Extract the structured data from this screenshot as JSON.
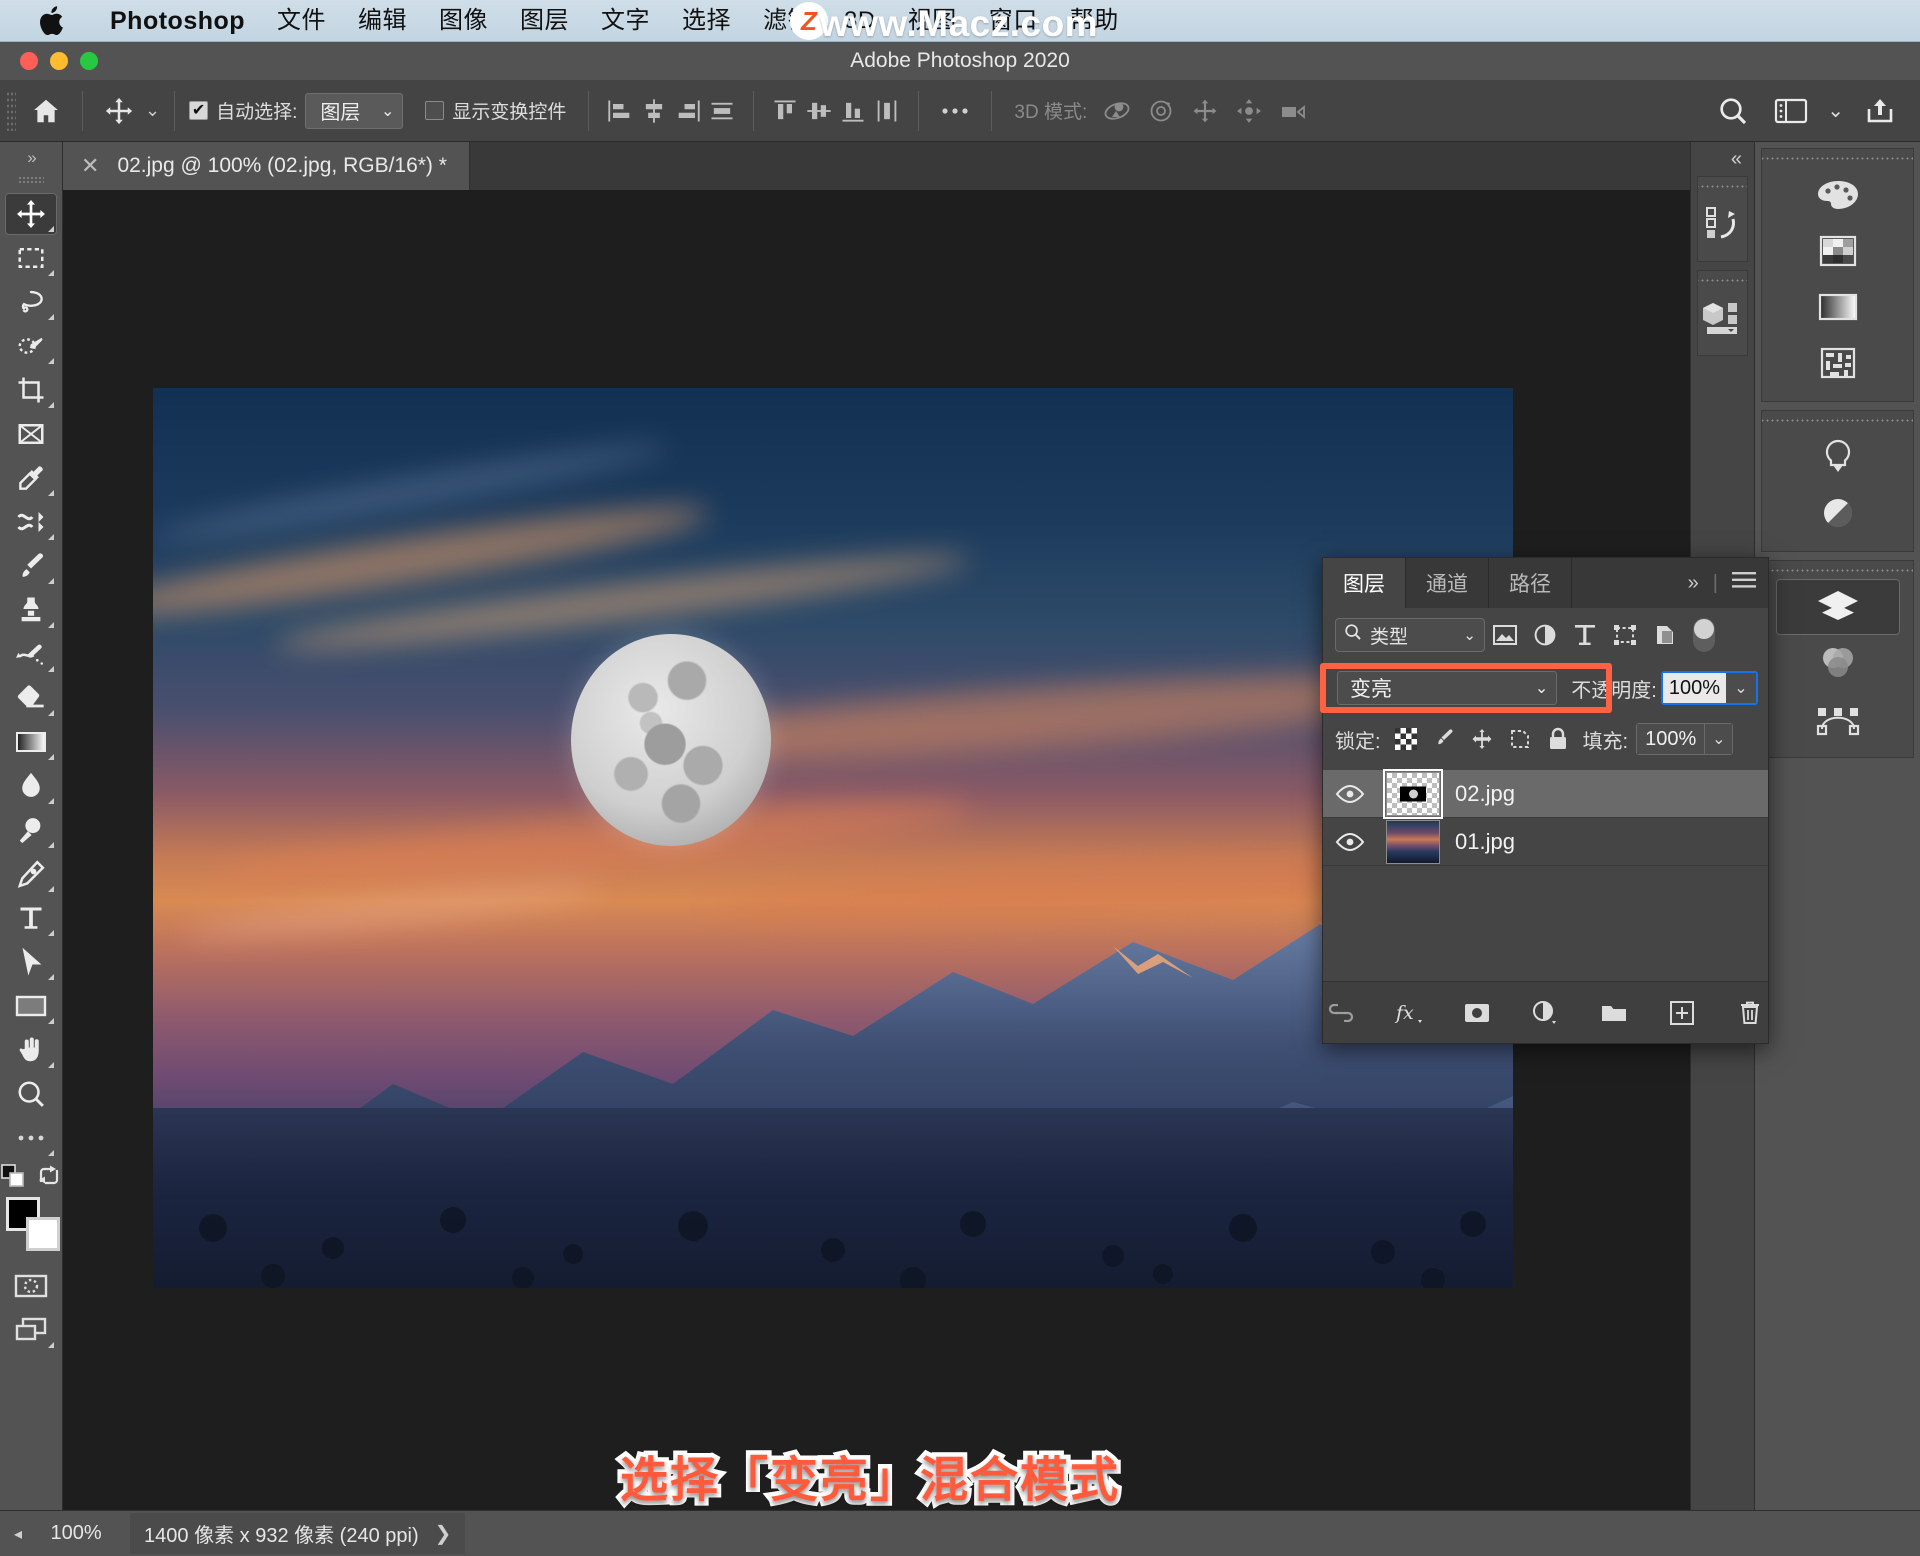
{
  "mac_menu": {
    "apple_icon": "apple-logo-icon",
    "items": [
      {
        "label": "Photoshop",
        "bold": true
      },
      {
        "label": "文件"
      },
      {
        "label": "编辑"
      },
      {
        "label": "图像"
      },
      {
        "label": "图层"
      },
      {
        "label": "文字"
      },
      {
        "label": "选择"
      },
      {
        "label": "滤镜"
      },
      {
        "label": "3D"
      },
      {
        "label": "视图"
      },
      {
        "label": "窗口"
      },
      {
        "label": "帮助"
      }
    ]
  },
  "watermark": {
    "text": "www.Macz.com",
    "badge": "Z"
  },
  "window": {
    "title": "Adobe Photoshop 2020"
  },
  "options_bar": {
    "home_icon": "home-icon",
    "tool_icon": "move-tool-icon",
    "auto_select_label": "自动选择:",
    "auto_select_checked": true,
    "auto_select_value": "图层",
    "show_transform_label": "显示变换控件",
    "show_transform_checked": false,
    "align_left_icon": "align-left-icon",
    "align_center_h_icon": "align-center-horizontal-icon",
    "align_right_icon": "align-right-icon",
    "distribute_h_icon": "distribute-horizontal-icon",
    "align_top_icon": "align-top-icon",
    "align_middle_icon": "align-middle-vertical-icon",
    "align_bottom_icon": "align-bottom-icon",
    "distribute_v_icon": "distribute-vertical-icon",
    "more_icon": "more-options-icon",
    "mode_3d_label": "3D 模式:",
    "mode_3d_icons": [
      "rotate-3d-icon",
      "roll-3d-icon",
      "pan-3d-icon",
      "slide-3d-icon",
      "scale-3d-icon"
    ],
    "search_icon": "search-icon",
    "workspace_icon": "workspace-icon",
    "workspace_chevron_icon": "chevron-down-icon",
    "share_icon": "share-icon"
  },
  "toolbar": {
    "expand_icon": "expand-panel-icon",
    "tools": [
      {
        "name": "move-tool",
        "icon": "move-tool-icon",
        "active": true,
        "has_flyout": true
      },
      {
        "name": "marquee-tool",
        "icon": "rectangular-marquee-icon",
        "active": false,
        "has_flyout": true
      },
      {
        "name": "lasso-tool",
        "icon": "lasso-icon",
        "active": false,
        "has_flyout": true
      },
      {
        "name": "quick-selection-tool",
        "icon": "quick-selection-icon",
        "active": false,
        "has_flyout": true
      },
      {
        "name": "crop-tool",
        "icon": "crop-icon",
        "active": false,
        "has_flyout": true
      },
      {
        "name": "frame-tool",
        "icon": "frame-icon",
        "active": false,
        "has_flyout": false
      },
      {
        "name": "eyedropper-tool",
        "icon": "eyedropper-icon",
        "active": false,
        "has_flyout": true
      },
      {
        "name": "healing-brush-tool",
        "icon": "healing-brush-icon",
        "active": false,
        "has_flyout": true
      },
      {
        "name": "brush-tool",
        "icon": "brush-icon",
        "active": false,
        "has_flyout": true
      },
      {
        "name": "clone-stamp-tool",
        "icon": "clone-stamp-icon",
        "active": false,
        "has_flyout": true
      },
      {
        "name": "history-brush-tool",
        "icon": "history-brush-icon",
        "active": false,
        "has_flyout": true
      },
      {
        "name": "eraser-tool",
        "icon": "eraser-icon",
        "active": false,
        "has_flyout": true
      },
      {
        "name": "gradient-tool",
        "icon": "gradient-icon",
        "active": false,
        "has_flyout": true
      },
      {
        "name": "blur-tool",
        "icon": "blur-drop-icon",
        "active": false,
        "has_flyout": true
      },
      {
        "name": "dodge-tool",
        "icon": "dodge-icon",
        "active": false,
        "has_flyout": true
      },
      {
        "name": "pen-tool",
        "icon": "pen-icon",
        "active": false,
        "has_flyout": true
      },
      {
        "name": "type-tool",
        "icon": "type-icon",
        "active": false,
        "has_flyout": true
      },
      {
        "name": "path-selection-tool",
        "icon": "path-selection-arrow-icon",
        "active": false,
        "has_flyout": true
      },
      {
        "name": "rectangle-tool",
        "icon": "rectangle-shape-icon",
        "active": false,
        "has_flyout": true
      },
      {
        "name": "hand-tool",
        "icon": "hand-icon",
        "active": false,
        "has_flyout": true
      },
      {
        "name": "zoom-tool",
        "icon": "zoom-magnifier-icon",
        "active": false,
        "has_flyout": false
      },
      {
        "name": "edit-toolbar",
        "icon": "ellipsis-icon",
        "active": false,
        "has_flyout": true
      }
    ],
    "foreground_color": "#000000",
    "background_color": "#ffffff",
    "swap_icon": "swap-colors-icon",
    "default_colors_icon": "default-colors-icon",
    "quick_mask_icon": "quick-mask-icon",
    "screen_mode_icon": "screen-mode-icon"
  },
  "document": {
    "tab_label": "02.jpg @ 100% (02.jpg, RGB/16*) *",
    "close_icon": "close-icon"
  },
  "layers_panel": {
    "tabs": [
      {
        "label": "图层",
        "active": true
      },
      {
        "label": "通道",
        "active": false
      },
      {
        "label": "路径",
        "active": false
      }
    ],
    "overflow_icon": "chevron-double-right-icon",
    "menu_icon": "panel-menu-icon",
    "filter": {
      "search_icon": "search-icon",
      "label": "类型",
      "chevron_icon": "chevron-down-icon",
      "type_icons": [
        "pixel-layer-filter-icon",
        "adjustment-layer-filter-icon",
        "type-layer-filter-icon",
        "shape-layer-filter-icon",
        "smart-object-filter-icon"
      ],
      "toggle_icon": "filter-toggle-icon"
    },
    "blend_mode": "变亮",
    "blend_chevron_icon": "chevron-down-icon",
    "opacity_label": "不透明度:",
    "opacity_value": "100%",
    "opacity_chevron_icon": "chevron-down-icon",
    "highlight_color": "#ff6242",
    "lock_label": "锁定:",
    "lock_icons": [
      "lock-transparent-pixels-icon",
      "lock-image-pixels-icon",
      "lock-position-icon",
      "lock-artboard-icon",
      "lock-all-icon"
    ],
    "fill_label": "填充:",
    "fill_value": "100%",
    "fill_chevron_icon": "chevron-down-icon",
    "layers": [
      {
        "name": "02.jpg",
        "visible": true,
        "selected": true,
        "thumb": "transparent-moon",
        "eye_icon": "eye-icon"
      },
      {
        "name": "01.jpg",
        "visible": true,
        "selected": false,
        "thumb": "landscape-photo",
        "eye_icon": "eye-icon"
      }
    ],
    "footer_icons": [
      "link-layers-icon",
      "layer-style-fx-icon",
      "add-layer-mask-icon",
      "new-adjustment-layer-icon",
      "new-group-icon",
      "new-layer-icon",
      "delete-layer-icon"
    ]
  },
  "right_dock": {
    "collapse_icon": "chevron-double-left-icon",
    "narrow_groups": [
      {
        "icons": [
          "history-icon"
        ]
      },
      {
        "icons": [
          "3d-icon"
        ]
      }
    ],
    "wide_groups": [
      {
        "icons": [
          "color-palette-icon",
          "swatches-grid-icon",
          "gradients-icon",
          "patterns-icon"
        ]
      },
      {
        "icons": [
          "learn-bulb-icon",
          "adjustments-icon"
        ]
      },
      {
        "icons": [
          "layers-icon",
          "channels-icon",
          "paths-icon"
        ]
      }
    ],
    "selected_icon": "layers-icon"
  },
  "annotation": {
    "text": "选择「变亮」混合模式",
    "color": "#ff5a3c"
  },
  "status_bar": {
    "zoom": "100%",
    "doc_info": "1400 像素 x 932 像素 (240 ppi)",
    "chevron_icon": "chevron-right-icon"
  }
}
